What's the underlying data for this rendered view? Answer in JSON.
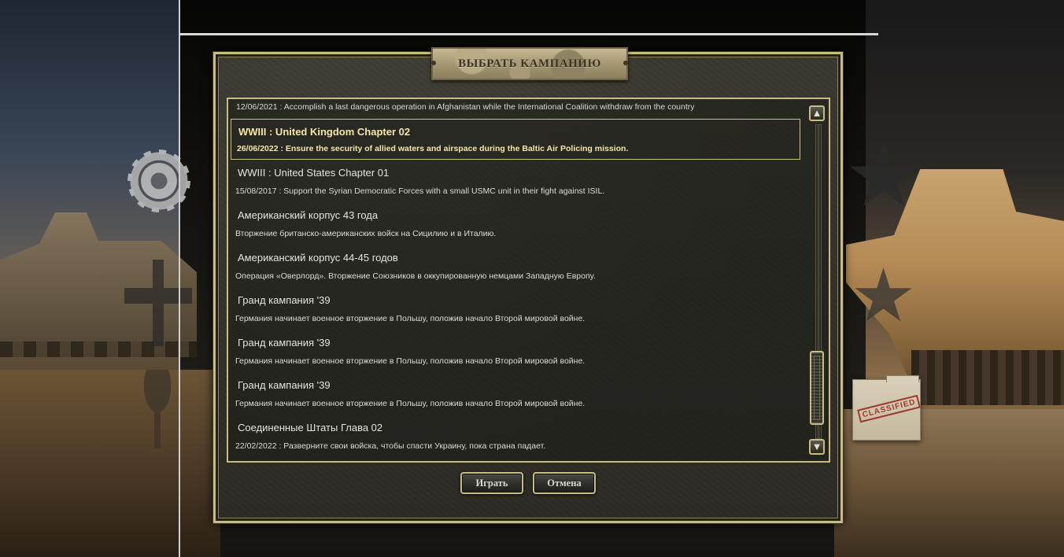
{
  "dialog": {
    "title": "ВЫБРАТЬ КАМПАНИЮ",
    "first_line_text": "12/06/2021 : Accomplish a last dangerous operation in Afghanistan while the International Coalition withdraw from the country",
    "selected_index": 0,
    "campaigns": [
      {
        "title": "WWIII : United Kingdom Chapter 02",
        "desc": "26/06/2022 : Ensure the security of allied waters and airspace during the Baltic Air Policing mission."
      },
      {
        "title": "WWIII : United States Chapter 01",
        "desc": "15/08/2017 : Support the Syrian Democratic Forces with a small USMC unit in their fight against ISIL."
      },
      {
        "title": "Американский корпус 43 года",
        "desc": "Вторжение британско-американских войск на Сицилию и в Италию."
      },
      {
        "title": "Американский корпус 44-45 годов",
        "desc": "Операция «Оверлорд». Вторжение Союзников в оккупированную немцами Западную Европу."
      },
      {
        "title": "Гранд кампания '39",
        "desc": "Германия начинает военное вторжение в Польшу, положив начало Второй мировой войне."
      },
      {
        "title": "Гранд кампания '39",
        "desc": "Германия начинает военное вторжение в Польшу, положив начало Второй мировой войне."
      },
      {
        "title": "Гранд кампания '39",
        "desc": "Германия начинает военное вторжение в Польшу, положив начало Второй мировой войне."
      },
      {
        "title": "Соединенные Штаты Глава 02",
        "desc": "22/02/2022 : Разверните свои войска, чтобы спасти Украину, пока страна падает."
      }
    ],
    "buttons": {
      "play": "Играть",
      "cancel": "Отмена"
    },
    "scroll_up_icon": "arrow-up-icon",
    "scroll_down_icon": "arrow-down-icon"
  },
  "background": {
    "folder_stamp": "CLASSIFIED"
  },
  "colors": {
    "frame_gold": "#c9bb84",
    "selected_text": "#f5e6a8",
    "panel": "#33332b"
  }
}
